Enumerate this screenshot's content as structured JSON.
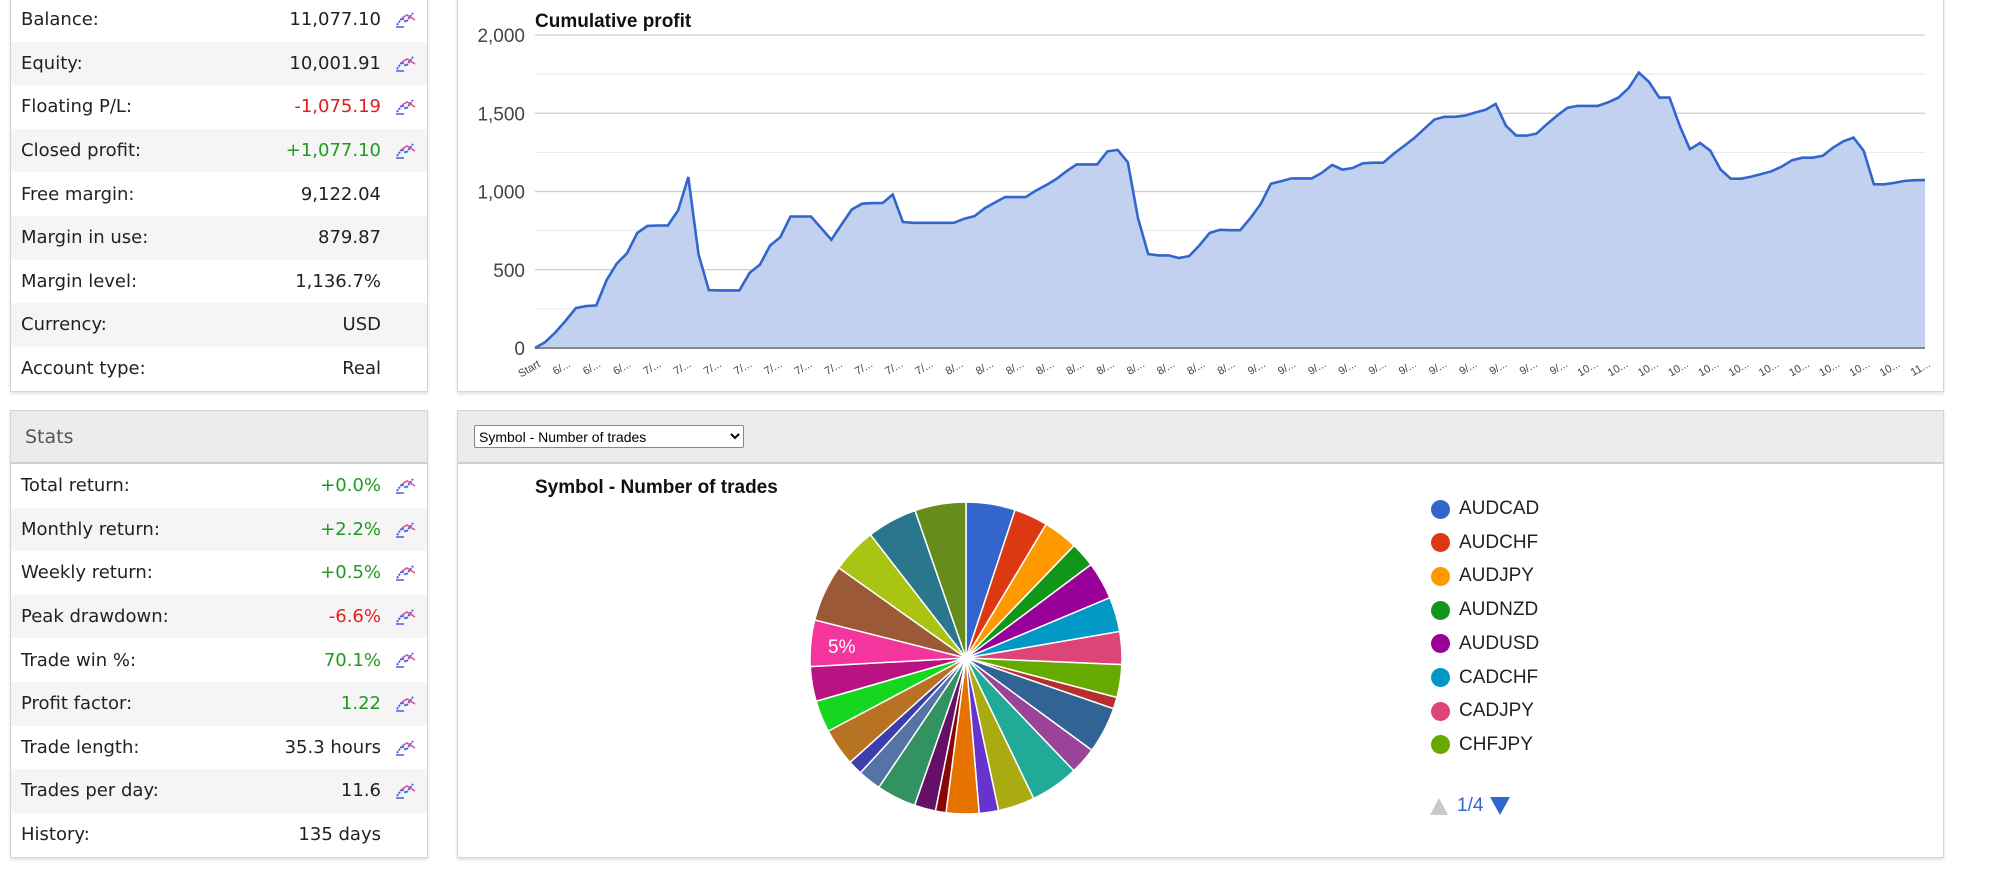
{
  "account": {
    "rows": [
      {
        "label": "Balance:",
        "value": "11,077.10",
        "tone": "",
        "icon": "chart-line-icon"
      },
      {
        "label": "Equity:",
        "value": "10,001.91",
        "tone": "",
        "icon": "chart-line-icon"
      },
      {
        "label": "Floating P/L:",
        "value": "-1,075.19",
        "tone": "neg",
        "icon": "chart-line-icon"
      },
      {
        "label": "Closed profit:",
        "value": "+1,077.10",
        "tone": "pos",
        "icon": "chart-line-icon"
      },
      {
        "label": "Free margin:",
        "value": "9,122.04",
        "tone": ""
      },
      {
        "label": "Margin in use:",
        "value": "879.87",
        "tone": ""
      },
      {
        "label": "Margin level:",
        "value": "1,136.7%",
        "tone": ""
      },
      {
        "label": "Currency:",
        "value": "USD",
        "tone": ""
      },
      {
        "label": "Account type:",
        "value": "Real",
        "tone": ""
      }
    ]
  },
  "stats": {
    "title": "Stats",
    "rows": [
      {
        "label": "Total return:",
        "value": "+0.0%",
        "tone": "pos",
        "icon": "chart-line-icon"
      },
      {
        "label": "Monthly return:",
        "value": "+2.2%",
        "tone": "pos",
        "icon": "chart-line-icon"
      },
      {
        "label": "Weekly return:",
        "value": "+0.5%",
        "tone": "pos",
        "icon": "chart-line-icon"
      },
      {
        "label": "Peak drawdown:",
        "value": "-6.6%",
        "tone": "neg",
        "icon": "chart-line-icon"
      },
      {
        "label": "Trade win %:",
        "value": "70.1%",
        "tone": "pos",
        "icon": "chart-line-icon"
      },
      {
        "label": "Profit factor:",
        "value": "1.22",
        "tone": "pos",
        "icon": "chart-line-icon"
      },
      {
        "label": "Trade length:",
        "value": "35.3 hours",
        "tone": "",
        "icon": "chart-line-icon"
      },
      {
        "label": "Trades per day:",
        "value": "11.6",
        "tone": "",
        "icon": "chart-line-icon"
      },
      {
        "label": "History:",
        "value": "135 days",
        "tone": ""
      }
    ]
  },
  "colors": {
    "positive": "#1f9a1f",
    "negative": "#e02020",
    "line": "#3366cc",
    "area": "#c3d1f1"
  },
  "breakdown_select": {
    "selected": "Symbol - Number of trades"
  },
  "chart_data": [
    {
      "type": "area",
      "title": "Cumulative profit",
      "ylim": [
        0,
        2000
      ],
      "yticks": [
        0,
        500,
        1000,
        1500,
        2000
      ],
      "ytick_labels": [
        "0",
        "500",
        "1,000",
        "1,500",
        "2,000"
      ],
      "grid": true,
      "xtick_labels": [
        "Start",
        "6/...",
        "6/...",
        "6/...",
        "7/...",
        "7/...",
        "7/...",
        "7/...",
        "7/...",
        "7/...",
        "7/...",
        "7/...",
        "7/...",
        "7/...",
        "8/...",
        "8/...",
        "8/...",
        "8/...",
        "8/...",
        "8/...",
        "8/...",
        "8/...",
        "8/...",
        "8/...",
        "9/...",
        "9/...",
        "9/...",
        "9/...",
        "9/...",
        "9/...",
        "9/...",
        "9/...",
        "9/...",
        "9/...",
        "9/...",
        "10...",
        "10...",
        "10...",
        "10...",
        "10...",
        "10...",
        "10...",
        "10...",
        "10...",
        "10...",
        "10...",
        "11..."
      ],
      "values": [
        0,
        38,
        100,
        175,
        255,
        268,
        272,
        432,
        540,
        605,
        735,
        780,
        783,
        783,
        879,
        1092,
        600,
        370,
        368,
        368,
        368,
        480,
        532,
        655,
        708,
        840,
        840,
        840,
        766,
        692,
        790,
        885,
        922,
        926,
        926,
        981,
        805,
        800,
        800,
        800,
        800,
        800,
        826,
        842,
        893,
        930,
        964,
        964,
        964,
        1005,
        1040,
        1080,
        1130,
        1173,
        1173,
        1173,
        1256,
        1266,
        1187,
        830,
        600,
        592,
        592,
        575,
        587,
        655,
        735,
        755,
        753,
        753,
        830,
        920,
        1050,
        1065,
        1084,
        1084,
        1084,
        1120,
        1170,
        1140,
        1150,
        1180,
        1184,
        1184,
        1240,
        1290,
        1340,
        1400,
        1460,
        1477,
        1477,
        1485,
        1505,
        1522,
        1560,
        1420,
        1357,
        1357,
        1370,
        1430,
        1485,
        1535,
        1547,
        1547,
        1547,
        1570,
        1600,
        1660,
        1760,
        1700,
        1600,
        1600,
        1420,
        1270,
        1310,
        1260,
        1140,
        1082,
        1082,
        1095,
        1112,
        1130,
        1160,
        1200,
        1216,
        1216,
        1228,
        1280,
        1320,
        1345,
        1260,
        1046,
        1046,
        1055,
        1068,
        1072,
        1073
      ]
    },
    {
      "type": "pie",
      "title": "Symbol - Number of trades",
      "legend": "right",
      "legend_page": "1/4",
      "slices": [
        {
          "name": "AUDCAD",
          "value": 5.1,
          "color": "#3366cc"
        },
        {
          "name": "AUDCHF",
          "value": 3.5,
          "color": "#dc3912"
        },
        {
          "name": "AUDJPY",
          "value": 3.6,
          "color": "#ff9900"
        },
        {
          "name": "AUDNZD",
          "value": 2.6,
          "color": "#109618"
        },
        {
          "name": "AUDUSD",
          "value": 3.9,
          "color": "#990099"
        },
        {
          "name": "CADCHF",
          "value": 3.6,
          "color": "#0099c6"
        },
        {
          "name": "CADJPY",
          "value": 3.4,
          "color": "#dd4477"
        },
        {
          "name": "CHFJPY",
          "value": 3.4,
          "color": "#66aa00"
        },
        {
          "value": 1.2,
          "color": "#b82e2e"
        },
        {
          "value": 4.8,
          "color": "#316395"
        },
        {
          "value": 2.8,
          "color": "#994499"
        },
        {
          "value": 5.0,
          "color": "#22aa99"
        },
        {
          "value": 3.8,
          "color": "#aaaa11"
        },
        {
          "value": 2.0,
          "color": "#6633cc"
        },
        {
          "value": 3.4,
          "color": "#e67300"
        },
        {
          "value": 1.1,
          "color": "#8b0707"
        },
        {
          "value": 2.2,
          "color": "#651067"
        },
        {
          "value": 4.1,
          "color": "#329262"
        },
        {
          "value": 2.4,
          "color": "#5574a6"
        },
        {
          "value": 1.5,
          "color": "#3b3eac"
        },
        {
          "value": 3.9,
          "color": "#b77322"
        },
        {
          "value": 3.3,
          "color": "#16d620"
        },
        {
          "value": 3.6,
          "color": "#b91383"
        },
        {
          "value": 4.8,
          "color": "#f4359e",
          "label": "5%"
        },
        {
          "value": 5.9,
          "color": "#9c5935"
        },
        {
          "value": 4.7,
          "color": "#a9c413"
        },
        {
          "value": 5.2,
          "color": "#2a778d"
        },
        {
          "value": 5.3,
          "color": "#668d1c"
        }
      ]
    }
  ]
}
